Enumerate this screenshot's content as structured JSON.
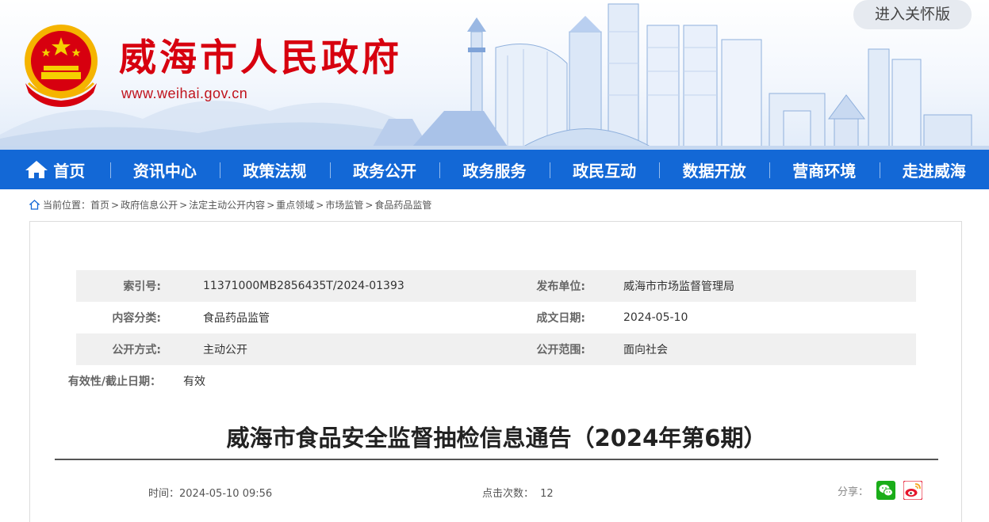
{
  "header": {
    "site_title": "威海市人民政府",
    "site_url": "www.weihai.gov.cn",
    "elder_mode_label": "进入关怀版"
  },
  "nav": {
    "items": [
      "首页",
      "资讯中心",
      "政策法规",
      "政务公开",
      "政务服务",
      "政民互动",
      "数据开放",
      "营商环境",
      "走进威海"
    ]
  },
  "breadcrumb": {
    "prefix": "当前位置：",
    "items": [
      "首页",
      "政府信息公开",
      "法定主动公开内容",
      "重点领域",
      "市场监管",
      "食品药品监管"
    ],
    "separator": ">"
  },
  "meta": {
    "index_label": "索引号:",
    "index_value": "11371000MB2856435T/2024-01393",
    "publisher_label": "发布单位:",
    "publisher_value": "威海市市场监督管理局",
    "category_label": "内容分类:",
    "category_value": "食品药品监管",
    "date_label": "成文日期:",
    "date_value": "2024-05-10",
    "mode_label": "公开方式:",
    "mode_value": "主动公开",
    "scope_label": "公开范围:",
    "scope_value": "面向社会",
    "validity_label": "有效性/截止日期：",
    "validity_value": "有效"
  },
  "article": {
    "title": "威海市食品安全监督抽检信息通告（2024年第6期）",
    "time_label": "时间：",
    "time_value": "2024-05-10 09:56",
    "clicks_label": "点击次数：",
    "clicks_value": "12",
    "share_label": "分享："
  },
  "colors": {
    "brand_red": "#d7000f",
    "nav_blue": "#1368d6"
  },
  "icons": {
    "home": "home-icon",
    "location": "location-icon",
    "wechat": "wechat-icon",
    "weibo": "weibo-icon"
  }
}
